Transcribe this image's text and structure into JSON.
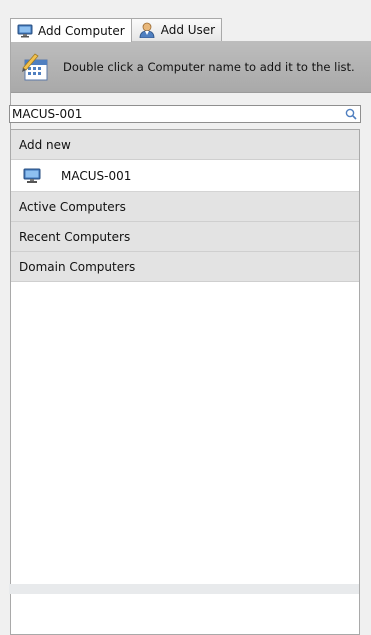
{
  "tabs": [
    {
      "label": "Add Computer",
      "icon": "computer-icon",
      "active": true
    },
    {
      "label": "Add User",
      "icon": "user-icon",
      "active": false
    }
  ],
  "hint": {
    "icon": "calendar-pencil-icon",
    "text": "Double click a Computer name to add it to the list."
  },
  "search": {
    "value": "MACUS-001",
    "icon": "search-icon"
  },
  "list": {
    "add_new": {
      "label": "Add new",
      "items": [
        {
          "label": "MACUS-001",
          "icon": "computer-icon"
        }
      ]
    },
    "active_computers": {
      "label": "Active Computers"
    },
    "recent_computers": {
      "label": "Recent Computers"
    },
    "domain_computers": {
      "label": "Domain Computers"
    }
  },
  "colors": {
    "hint_bar": "#a9a9a9",
    "group_header": "#e3e3e3",
    "accent_blue": "#2a6db5"
  }
}
